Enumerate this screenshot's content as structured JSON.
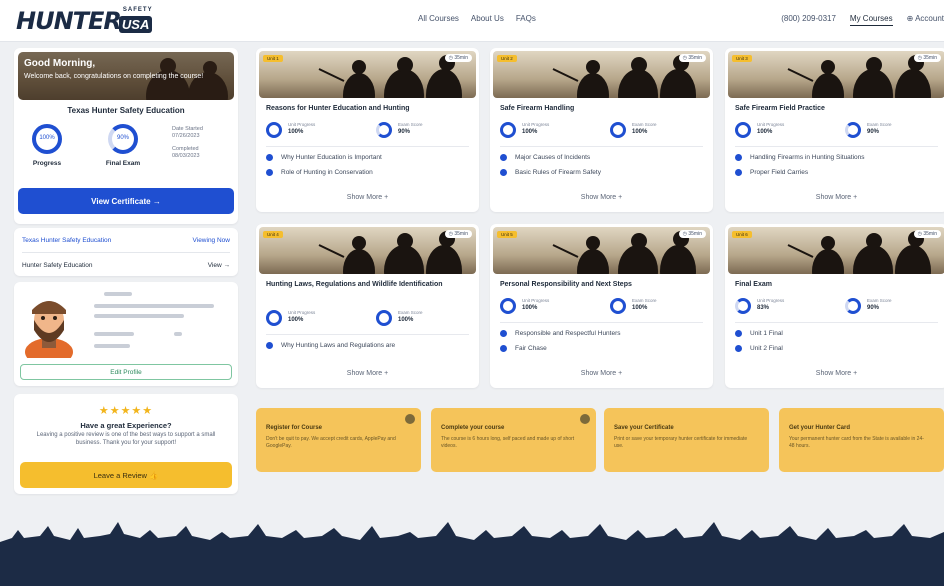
{
  "header": {
    "logo_main": "HUNTER",
    "logo_badge": "USA",
    "logo_small": "SAFETY",
    "nav": [
      "All Courses",
      "About Us",
      "FAQs"
    ],
    "phone": "(800) 209-0317",
    "my_courses": "My Courses",
    "account": "Account"
  },
  "welcome": {
    "greeting": "Good Morning,",
    "message": "Welcome back, congratulations on completing the course!",
    "course_title": "Texas Hunter Safety Education",
    "progress_value": "100%",
    "progress_label": "Progress",
    "final_exam_value": "90%",
    "final_exam_label": "Final Exam",
    "date_started_label": "Date Started",
    "date_started": "07/26/2023",
    "completed_label": "Completed",
    "completed": "08/03/2023",
    "view_certificate": "View Certificate →"
  },
  "course_list": {
    "row1_name": "Texas Hunter Safety Education",
    "row1_action": "Viewing Now",
    "row2_name": "Hunter Safety Education",
    "row2_action": "View →"
  },
  "profile": {
    "edit_button": "Edit Profile"
  },
  "review": {
    "stars": "★★★★★",
    "title": "Have a great Experience?",
    "text": "Leaving a positive review is one of the best ways to support a small business. Thank you for your support!",
    "button": "Leave a Review 👍"
  },
  "modules": [
    {
      "unit": "Unit 1",
      "time": "35min",
      "title": "Reasons for Hunter Education and Hunting",
      "unit_progress_label": "Unit Progress",
      "unit_progress": "100%",
      "exam_label": "Exam Score",
      "exam_score": "90%",
      "items": [
        "Why Hunter Education is Important",
        "Role of Hunting in Conservation"
      ],
      "show_more": "Show More +"
    },
    {
      "unit": "Unit 2",
      "time": "35min",
      "title": "Safe Firearm Handling",
      "unit_progress_label": "Unit Progress",
      "unit_progress": "100%",
      "exam_label": "Exam Score",
      "exam_score": "100%",
      "items": [
        "Major Causes of Incidents",
        "Basic Rules of Firearm Safety"
      ],
      "show_more": "Show More +"
    },
    {
      "unit": "Unit 3",
      "time": "35min",
      "title": "Safe Firearm Field Practice",
      "unit_progress_label": "Unit Progress",
      "unit_progress": "100%",
      "exam_label": "Exam Score",
      "exam_score": "90%",
      "items": [
        "Handling Firearms in Hunting Situations",
        "Proper Field Carries"
      ],
      "show_more": "Show More +"
    },
    {
      "unit": "Unit 4",
      "time": "35min",
      "title": "Hunting Laws, Regulations and Wildlife Identification",
      "unit_progress_label": "Unit Progress",
      "unit_progress": "100%",
      "exam_label": "Exam Score",
      "exam_score": "100%",
      "items": [
        "Why Hunting Laws and Regulations are"
      ],
      "show_more": "Show More +"
    },
    {
      "unit": "Unit 5",
      "time": "35min",
      "title": "Personal Responsibility and Next Steps",
      "unit_progress_label": "Unit Progress",
      "unit_progress": "100%",
      "exam_label": "Exam Score",
      "exam_score": "100%",
      "items": [
        "Responsible and Respectful Hunters",
        "Fair Chase"
      ],
      "show_more": "Show More +"
    },
    {
      "unit": "Unit 6",
      "time": "35min",
      "title": "Final Exam",
      "unit_progress_label": "Unit Progress",
      "unit_progress": "83%",
      "exam_label": "Exam Score",
      "exam_score": "90%",
      "items": [
        "Unit 1 Final",
        "Unit 2 Final"
      ],
      "show_more": "Show More +"
    }
  ],
  "steps": [
    {
      "title": "Register for Course",
      "text": "Don't be quit to pay. We accept credit cards, ApplePay and GooglePay."
    },
    {
      "title": "Complete your course",
      "text": "The course is 6 hours long, self paced and made up of short videos."
    },
    {
      "title": "Save your Certificate",
      "text": "Print or save your temporary hunter certificate for immediate use."
    },
    {
      "title": "Get your Hunter Card",
      "text": "Your permanent hunter card from the State is available in 24-48 hours."
    }
  ],
  "colors": {
    "primary": "#1f4fd1",
    "accent_yellow": "#f5be2e",
    "forest": "#1c2b45"
  }
}
